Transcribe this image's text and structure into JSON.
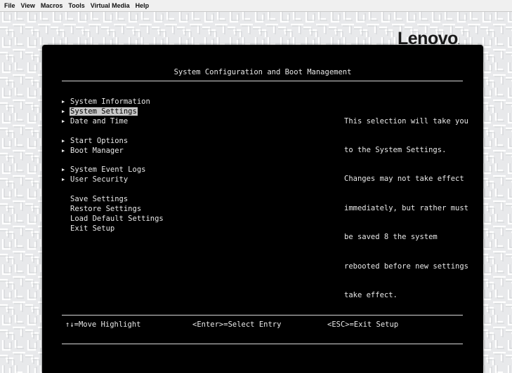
{
  "menubar": {
    "items": [
      "File",
      "View",
      "Macros",
      "Tools",
      "Virtual Media",
      "Help"
    ]
  },
  "brand": {
    "name": "Lenovo",
    "suffix": "."
  },
  "bios": {
    "title": "System Configuration and Boot Management",
    "menu": [
      {
        "label": "System Information",
        "arrow": true,
        "selected": false
      },
      {
        "label": "System Settings",
        "arrow": true,
        "selected": true
      },
      {
        "label": "Date and Time",
        "arrow": true,
        "selected": false
      },
      {
        "label": "Start Options",
        "arrow": true,
        "selected": false
      },
      {
        "label": "Boot Manager",
        "arrow": true,
        "selected": false
      },
      {
        "label": "System Event Logs",
        "arrow": true,
        "selected": false
      },
      {
        "label": "User Security",
        "arrow": true,
        "selected": false
      },
      {
        "label": "Save Settings",
        "arrow": false,
        "selected": false
      },
      {
        "label": "Restore Settings",
        "arrow": false,
        "selected": false
      },
      {
        "label": "Load Default Settings",
        "arrow": false,
        "selected": false
      },
      {
        "label": "Exit Setup",
        "arrow": false,
        "selected": false
      }
    ],
    "help_lines": [
      "This selection will take you",
      "to the System Settings.",
      "Changes may not take effect",
      "immediately, but rather must",
      "be saved 8 the system",
      "rebooted before new settings",
      "take effect."
    ],
    "footer": {
      "move": "↑↓=Move Highlight",
      "enter": "<Enter>=Select Entry",
      "esc": "<ESC>=Exit Setup"
    }
  },
  "colors": {
    "bios_bg": "#000000",
    "bios_text": "#e8e8e8",
    "highlight": "#c8c8c8",
    "desktop": "#e8e9eb"
  },
  "icons": {
    "submenu_arrow": "triangle-right-icon"
  }
}
